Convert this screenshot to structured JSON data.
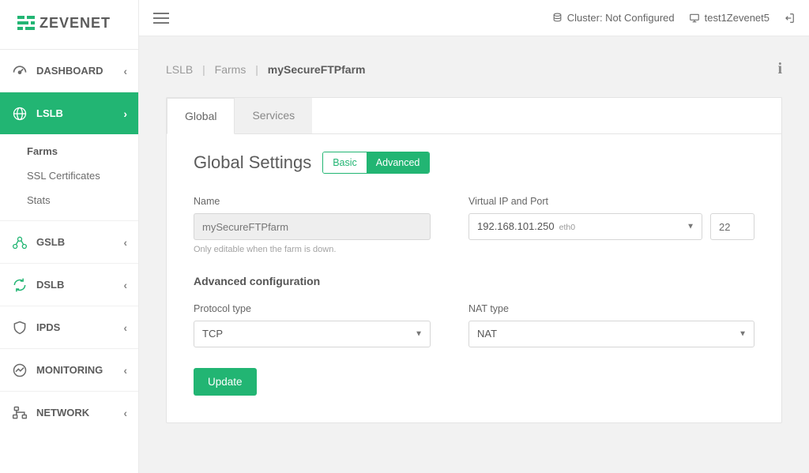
{
  "brand": {
    "name": "ZEVENET"
  },
  "topbar": {
    "cluster_label": "Cluster: Not Configured",
    "hostname": "test1Zevenet5"
  },
  "sidebar": {
    "items": [
      {
        "label": "DASHBOARD"
      },
      {
        "label": "LSLB",
        "children": [
          {
            "label": "Farms",
            "active": true
          },
          {
            "label": "SSL Certificates"
          },
          {
            "label": "Stats"
          }
        ]
      },
      {
        "label": "GSLB"
      },
      {
        "label": "DSLB"
      },
      {
        "label": "IPDS"
      },
      {
        "label": "MONITORING"
      },
      {
        "label": "NETWORK"
      }
    ]
  },
  "breadcrumb": {
    "a": "LSLB",
    "b": "Farms",
    "c": "mySecureFTPfarm"
  },
  "tabs": {
    "global": "Global",
    "services": "Services"
  },
  "section": {
    "title": "Global Settings",
    "toggle": {
      "basic": "Basic",
      "advanced": "Advanced"
    }
  },
  "form": {
    "name_label": "Name",
    "name_value": "mySecureFTPfarm",
    "name_help": "Only editable when the farm is down.",
    "vip_label": "Virtual IP and Port",
    "vip_ip": "192.168.101.250",
    "vip_iface": "eth0",
    "vip_port": "22",
    "advanced_heading": "Advanced configuration",
    "proto_label": "Protocol type",
    "proto_value": "TCP",
    "nat_label": "NAT type",
    "nat_value": "NAT",
    "update": "Update"
  }
}
